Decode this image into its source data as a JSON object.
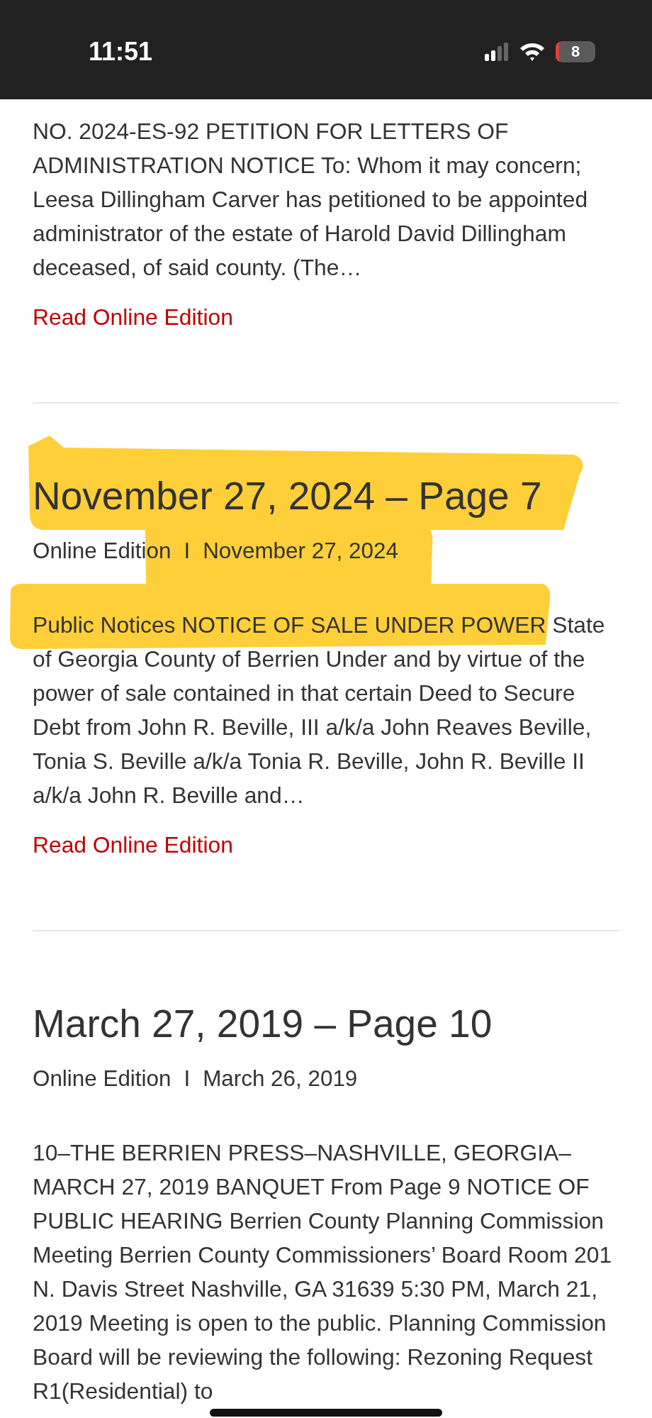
{
  "status_bar": {
    "time": "11:51",
    "battery": "8"
  },
  "articles": [
    {
      "excerpt": "NO. 2024-ES-92 PETITION FOR LETTERS OF ADMINISTRATION NOTICE To: Whom it may concern; Leesa Dillingham Carver has petitioned to be appointed administrator of the estate of Harold David Dillingham deceased, of said county. (The…",
      "link": "Read Online Edition"
    },
    {
      "title": "November 27, 2024 – Page 7",
      "meta": {
        "category": "Online Edition",
        "separator": "I",
        "date": "November 27, 2024"
      },
      "excerpt": "Public Notices NOTICE OF SALE UNDER POWER State of Georgia County of Berrien Under and by virtue of the power of sale contained in that certain Deed to Secure Debt from John R. Beville, III a/k/a John Reaves Beville, Tonia S. Beville a/k/a Tonia R. Beville, John R. Beville II a/k/a John R. Beville and…",
      "link": "Read Online Edition",
      "marker_highlight": true
    },
    {
      "title": "March 27, 2019 – Page 10",
      "meta": {
        "category": "Online Edition",
        "separator": "I",
        "date": "March 26, 2019"
      },
      "excerpt": "10–THE BERRIEN PRESS–NASHVILLE, GEORGIA–MARCH 27, 2019 BANQUET From Page 9 NOTICE OF PUBLIC HEARING Berrien County Planning Commission Meeting Berrien County Commissioners’ Board Room 201 N. Davis Street Nashville, GA 31639 5:30 PM, March 21, 2019 Meeting is open to the public. Planning Commission Board will be reviewing the following: Rezoning Request R1(Residential) to"
    }
  ]
}
